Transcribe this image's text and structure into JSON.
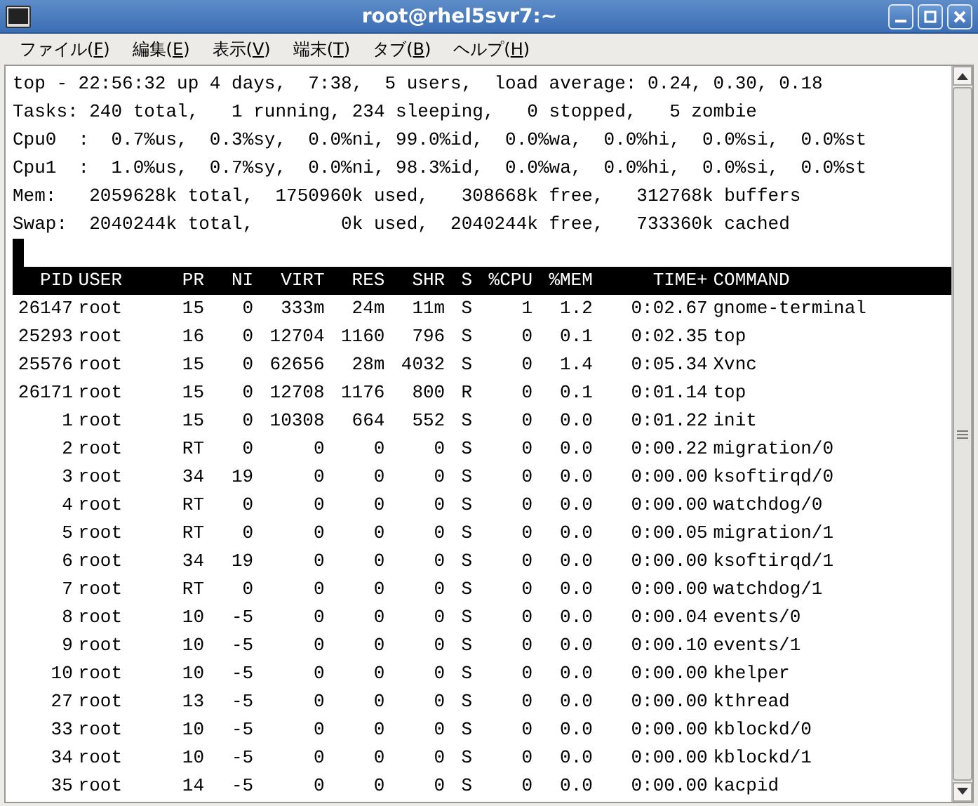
{
  "window": {
    "title": "root@rhel5svr7:~"
  },
  "menu": [
    {
      "before": "ファイル(",
      "key": "F",
      "after": ")"
    },
    {
      "before": "編集(",
      "key": "E",
      "after": ")"
    },
    {
      "before": "表示(",
      "key": "V",
      "after": ")"
    },
    {
      "before": "端末(",
      "key": "T",
      "after": ")"
    },
    {
      "before": "タブ(",
      "key": "B",
      "after": ")"
    },
    {
      "before": "ヘルプ(",
      "key": "H",
      "after": ")"
    }
  ],
  "summary": [
    "top - 22:56:32 up 4 days,  7:38,  5 users,  load average: 0.24, 0.30, 0.18",
    "Tasks: 240 total,   1 running, 234 sleeping,   0 stopped,   5 zombie",
    "Cpu0  :  0.7%us,  0.3%sy,  0.0%ni, 99.0%id,  0.0%wa,  0.0%hi,  0.0%si,  0.0%st",
    "Cpu1  :  1.0%us,  0.7%sy,  0.0%ni, 98.3%id,  0.0%wa,  0.0%hi,  0.0%si,  0.0%st",
    "Mem:   2059628k total,  1750960k used,   308668k free,   312768k buffers",
    "Swap:  2040244k total,        0k used,  2040244k free,   733360k cached"
  ],
  "table": {
    "columns": [
      "PID",
      "USER",
      "PR",
      "NI",
      "VIRT",
      "RES",
      "SHR",
      "S",
      "%CPU",
      "%MEM",
      "TIME+",
      "COMMAND"
    ],
    "rows": [
      [
        "26147",
        "root",
        "15",
        "0",
        "333m",
        "24m",
        "11m",
        "S",
        "1",
        "1.2",
        "0:02.67",
        "gnome-terminal"
      ],
      [
        "25293",
        "root",
        "16",
        "0",
        "12704",
        "1160",
        "796",
        "S",
        "0",
        "0.1",
        "0:02.35",
        "top"
      ],
      [
        "25576",
        "root",
        "15",
        "0",
        "62656",
        "28m",
        "4032",
        "S",
        "0",
        "1.4",
        "0:05.34",
        "Xvnc"
      ],
      [
        "26171",
        "root",
        "15",
        "0",
        "12708",
        "1176",
        "800",
        "R",
        "0",
        "0.1",
        "0:01.14",
        "top"
      ],
      [
        "1",
        "root",
        "15",
        "0",
        "10308",
        "664",
        "552",
        "S",
        "0",
        "0.0",
        "0:01.22",
        "init"
      ],
      [
        "2",
        "root",
        "RT",
        "0",
        "0",
        "0",
        "0",
        "S",
        "0",
        "0.0",
        "0:00.22",
        "migration/0"
      ],
      [
        "3",
        "root",
        "34",
        "19",
        "0",
        "0",
        "0",
        "S",
        "0",
        "0.0",
        "0:00.00",
        "ksoftirqd/0"
      ],
      [
        "4",
        "root",
        "RT",
        "0",
        "0",
        "0",
        "0",
        "S",
        "0",
        "0.0",
        "0:00.00",
        "watchdog/0"
      ],
      [
        "5",
        "root",
        "RT",
        "0",
        "0",
        "0",
        "0",
        "S",
        "0",
        "0.0",
        "0:00.05",
        "migration/1"
      ],
      [
        "6",
        "root",
        "34",
        "19",
        "0",
        "0",
        "0",
        "S",
        "0",
        "0.0",
        "0:00.00",
        "ksoftirqd/1"
      ],
      [
        "7",
        "root",
        "RT",
        "0",
        "0",
        "0",
        "0",
        "S",
        "0",
        "0.0",
        "0:00.00",
        "watchdog/1"
      ],
      [
        "8",
        "root",
        "10",
        "-5",
        "0",
        "0",
        "0",
        "S",
        "0",
        "0.0",
        "0:00.04",
        "events/0"
      ],
      [
        "9",
        "root",
        "10",
        "-5",
        "0",
        "0",
        "0",
        "S",
        "0",
        "0.0",
        "0:00.10",
        "events/1"
      ],
      [
        "10",
        "root",
        "10",
        "-5",
        "0",
        "0",
        "0",
        "S",
        "0",
        "0.0",
        "0:00.00",
        "khelper"
      ],
      [
        "27",
        "root",
        "13",
        "-5",
        "0",
        "0",
        "0",
        "S",
        "0",
        "0.0",
        "0:00.00",
        "kthread"
      ],
      [
        "33",
        "root",
        "10",
        "-5",
        "0",
        "0",
        "0",
        "S",
        "0",
        "0.0",
        "0:00.00",
        "kblockd/0"
      ],
      [
        "34",
        "root",
        "10",
        "-5",
        "0",
        "0",
        "0",
        "S",
        "0",
        "0.0",
        "0:00.00",
        "kblockd/1"
      ],
      [
        "35",
        "root",
        "14",
        "-5",
        "0",
        "0",
        "0",
        "S",
        "0",
        "0.0",
        "0:00.00",
        "kacpid"
      ]
    ]
  }
}
